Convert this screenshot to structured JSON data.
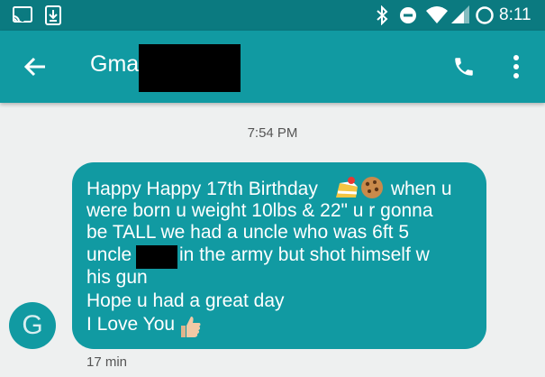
{
  "status_bar": {
    "time": "8:11",
    "icons": [
      "cast-icon",
      "download-icon",
      "bluetooth-icon",
      "do-not-disturb-icon",
      "wifi-icon",
      "signal-icon",
      "battery-icon"
    ]
  },
  "header": {
    "title": "Gma",
    "icons": [
      "back-arrow-icon",
      "phone-icon",
      "more-vert-icon"
    ]
  },
  "conversation": {
    "timestamp": "7:54 PM",
    "avatar_letter": "G",
    "message_lines": [
      "Happy Happy 17th Birthday",
      " when u",
      "were born u weight 10lbs & 22\" u r gonna",
      "be TALL we had a uncle who was 6ft 5",
      "uncle",
      "in the army but shot himself w",
      "his gun",
      "Hope u had a great day",
      "I Love You"
    ],
    "message_emojis": [
      "cake-emoji",
      "cookie-emoji",
      "thumbs-up-emoji"
    ],
    "sent_ago": "17 min"
  },
  "colors": {
    "status_bar": "#0b7a80",
    "app_bar": "#119aa2",
    "bubble": "#119aa2",
    "background": "#eef0f0"
  }
}
